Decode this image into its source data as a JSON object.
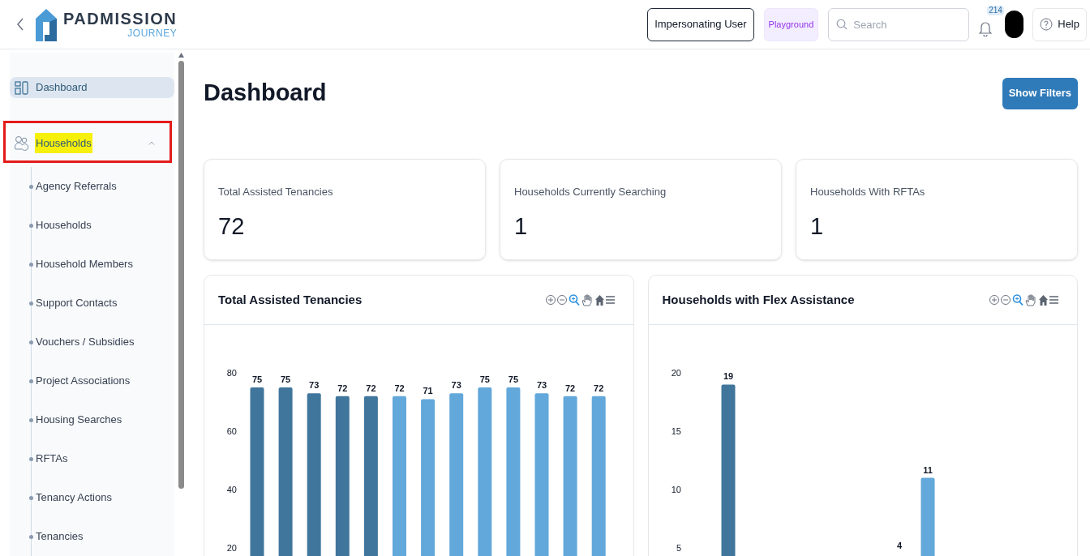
{
  "header": {
    "brand": "PADMISSION",
    "brand_sub": "JOURNEY",
    "impersonating_button": "Impersonating User",
    "environment_badge": "Playground",
    "search": {
      "placeholder": "Search"
    },
    "notifications_count": "214",
    "help_button": "Help"
  },
  "sidebar": {
    "items": [
      {
        "label": "Dashboard",
        "selected": true,
        "annotated": false
      },
      {
        "label": "Households",
        "selected": false,
        "expanded": true,
        "annotated": true,
        "children": [
          {
            "label": "Agency Referrals"
          },
          {
            "label": "Households"
          },
          {
            "label": "Household Members"
          },
          {
            "label": "Support Contacts"
          },
          {
            "label": "Vouchers / Subsidies"
          },
          {
            "label": "Project Associations"
          },
          {
            "label": "Housing Searches"
          },
          {
            "label": "RFTAs"
          },
          {
            "label": "Tenancy Actions"
          },
          {
            "label": "Tenancies"
          }
        ]
      }
    ]
  },
  "page": {
    "title": "Dashboard",
    "show_filters_button": "Show Filters"
  },
  "stats": [
    {
      "label": "Total Assisted Tenancies",
      "value": "72"
    },
    {
      "label": "Households Currently Searching",
      "value": "1"
    },
    {
      "label": "Households With RFTAs",
      "value": "1"
    }
  ],
  "charts": [
    {
      "title": "Total Assisted Tenancies",
      "chart_data": {
        "type": "bar",
        "stacked": true,
        "ylim": [
          0,
          80
        ],
        "yticks": [
          20,
          40,
          60,
          80
        ],
        "data_labels": true,
        "series": [
          {
            "color": "#41769c",
            "values": [
              75,
              75,
              73,
              72,
              72,
              null,
              null,
              null,
              null,
              null,
              null,
              null,
              null
            ]
          },
          {
            "color": "#62a8da",
            "values": [
              null,
              null,
              null,
              null,
              null,
              72,
              71,
              73,
              75,
              75,
              73,
              72,
              72
            ]
          }
        ]
      }
    },
    {
      "title": "Households with Flex Assistance",
      "chart_data": {
        "type": "bar",
        "stacked": true,
        "ylim": [
          0,
          20
        ],
        "yticks": [
          5,
          10,
          15,
          20
        ],
        "data_labels": true,
        "categories": [
          null,
          null
        ],
        "annotations": [
          "4"
        ],
        "series": [
          {
            "color": "#41769c",
            "values": [
              19,
              null
            ]
          },
          {
            "color": "#62a8da",
            "values": [
              null,
              11
            ]
          }
        ]
      }
    }
  ]
}
